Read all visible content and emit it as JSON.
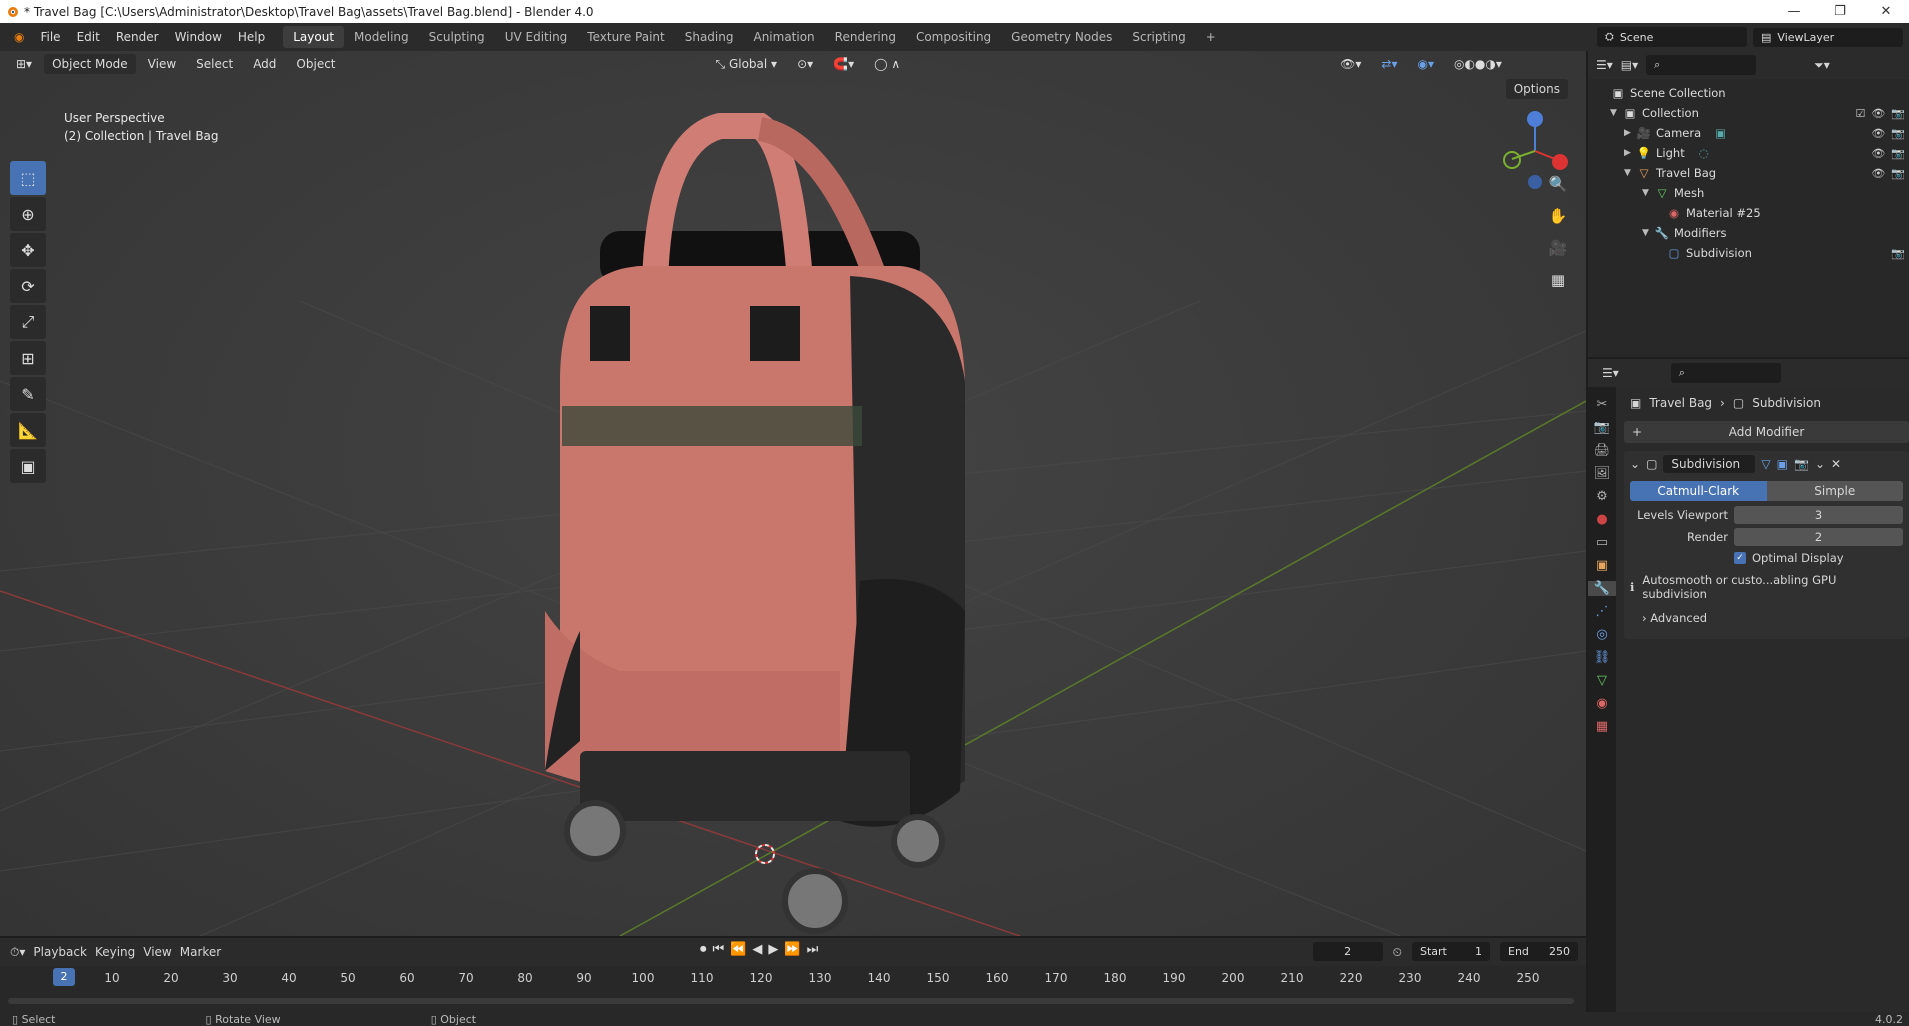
{
  "window": {
    "title": "* Travel Bag [C:\\Users\\Administrator\\Desktop\\Travel Bag\\assets\\Travel Bag.blend] - Blender 4.0",
    "minimize": "—",
    "maximize": "❐",
    "close": "✕"
  },
  "menu": [
    "File",
    "Edit",
    "Render",
    "Window",
    "Help"
  ],
  "workspaces": [
    "Layout",
    "Modeling",
    "Sculpting",
    "UV Editing",
    "Texture Paint",
    "Shading",
    "Animation",
    "Rendering",
    "Compositing",
    "Geometry Nodes",
    "Scripting"
  ],
  "scene": "Scene",
  "view_layer": "ViewLayer",
  "viewport": {
    "mode": "Object Mode",
    "menus": [
      "View",
      "Select",
      "Add",
      "Object"
    ],
    "orientation": "Global",
    "options": "Options",
    "overlay_line1": "User Perspective",
    "overlay_line2": "(2) Collection | Travel Bag"
  },
  "outliner": {
    "items": [
      {
        "label": "Scene Collection"
      },
      {
        "label": "Collection"
      },
      {
        "label": "Camera"
      },
      {
        "label": "Light"
      },
      {
        "label": "Travel Bag"
      },
      {
        "label": "Mesh"
      },
      {
        "label": "Material #25"
      },
      {
        "label": "Modifiers"
      },
      {
        "label": "Subdivision"
      }
    ]
  },
  "properties": {
    "breadcrumb_object": "Travel Bag",
    "breadcrumb_modifier": "Subdivision",
    "add_modifier": "Add Modifier",
    "modifier_name": "Subdivision",
    "type_catmull": "Catmull-Clark",
    "type_simple": "Simple",
    "levels_viewport_label": "Levels Viewport",
    "levels_viewport_value": "3",
    "render_label": "Render",
    "render_value": "2",
    "optimal_display": "Optimal Display",
    "info": "Autosmooth or custo...abling GPU subdivision",
    "advanced": "Advanced"
  },
  "timeline": {
    "playback": "Playback",
    "keying": "Keying",
    "view": "View",
    "marker": "Marker",
    "current_frame": "2",
    "start_label": "Start",
    "start_value": "1",
    "end_label": "End",
    "end_value": "250",
    "ticks": [
      "10",
      "20",
      "30",
      "40",
      "50",
      "60",
      "70",
      "80",
      "90",
      "100",
      "110",
      "120",
      "130",
      "140",
      "150",
      "160",
      "170",
      "180",
      "190",
      "200",
      "210",
      "220",
      "230",
      "240",
      "250"
    ]
  },
  "status": {
    "select": "Select",
    "rotate": "Rotate View",
    "object": "Object",
    "version": "4.0.2"
  }
}
